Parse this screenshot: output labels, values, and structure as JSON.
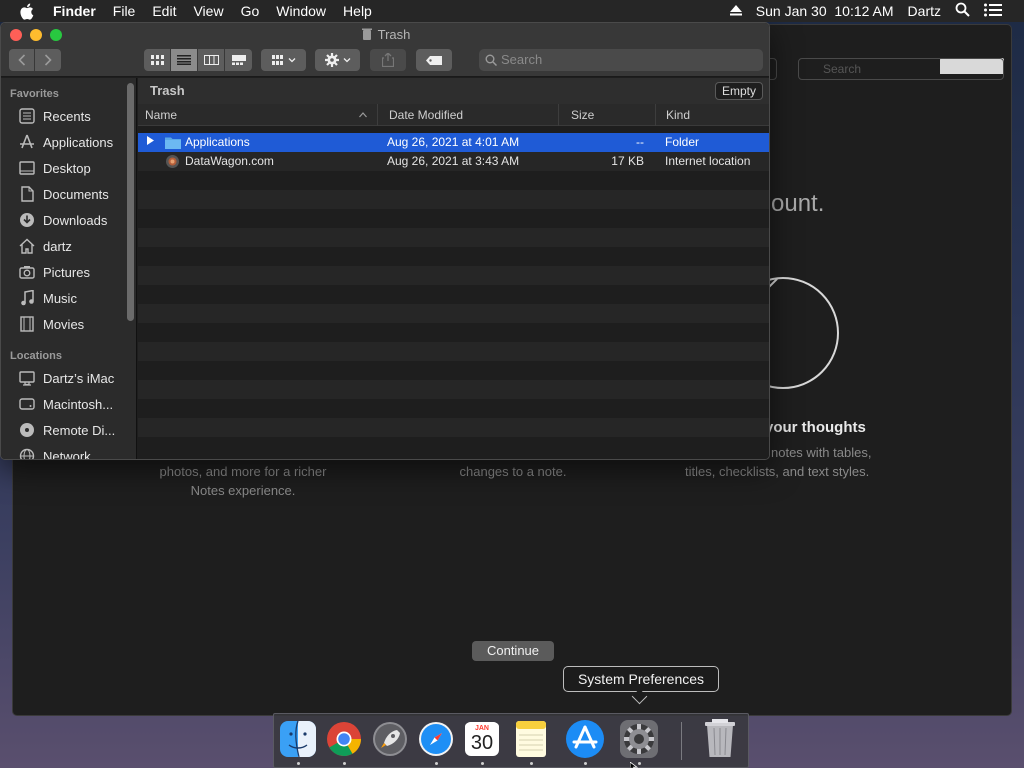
{
  "menubar": {
    "app_name": "Finder",
    "items": [
      "File",
      "Edit",
      "View",
      "Go",
      "Window",
      "Help"
    ],
    "datetime": "Sun Jan 30  10:12 AM",
    "user": "Dartz"
  },
  "background_notes": {
    "heading_partial": "ount.",
    "subheading_partial": "your thoughts",
    "left_text_1": "photos, and more for a richer",
    "left_text_2": "Notes experience.",
    "middle_text": "changes to a note.",
    "right_text_1": "notes with tables,",
    "right_text_2": "titles, checklists, and text styles.",
    "continue_label": "Continue",
    "search_placeholder": "Search"
  },
  "finder": {
    "window_title": "Trash",
    "search_placeholder": "Search",
    "path_title": "Trash",
    "empty_label": "Empty",
    "sidebar": {
      "favorites_header": "Favorites",
      "favorites": [
        {
          "label": "Recents",
          "icon": "clock-icon"
        },
        {
          "label": "Applications",
          "icon": "applications-icon"
        },
        {
          "label": "Desktop",
          "icon": "desktop-icon"
        },
        {
          "label": "Documents",
          "icon": "document-icon"
        },
        {
          "label": "Downloads",
          "icon": "download-icon"
        },
        {
          "label": "dartz",
          "icon": "home-icon"
        },
        {
          "label": "Pictures",
          "icon": "camera-icon"
        },
        {
          "label": "Music",
          "icon": "music-note-icon"
        },
        {
          "label": "Movies",
          "icon": "film-icon"
        }
      ],
      "locations_header": "Locations",
      "locations": [
        {
          "label": "Dartz’s iMac",
          "icon": "imac-icon"
        },
        {
          "label": "Macintosh...",
          "icon": "disk-icon"
        },
        {
          "label": "Remote Di...",
          "icon": "remote-disc-icon"
        },
        {
          "label": "Network",
          "icon": "network-icon"
        }
      ]
    },
    "columns": [
      "Name",
      "Date Modified",
      "Size",
      "Kind"
    ],
    "rows": [
      {
        "name": "Applications",
        "date": "Aug 26, 2021 at 4:01 AM",
        "size": "--",
        "kind": "Folder",
        "selected": true
      },
      {
        "name": "DataWagon.com",
        "date": "Aug 26, 2021 at 3:43 AM",
        "size": "17 KB",
        "kind": "Internet location",
        "selected": false
      }
    ]
  },
  "dock": {
    "apps": [
      "Finder",
      "Google Chrome",
      "Launchpad",
      "Safari",
      "Calendar",
      "Notes",
      "App Store",
      "System Preferences",
      "Trash"
    ],
    "calendar_month": "JAN",
    "calendar_day": "30",
    "tooltip": "System Preferences"
  },
  "colors": {
    "selection": "#1f5bd6",
    "menubar": "#262626",
    "window_bg": "#1e1e1e"
  }
}
